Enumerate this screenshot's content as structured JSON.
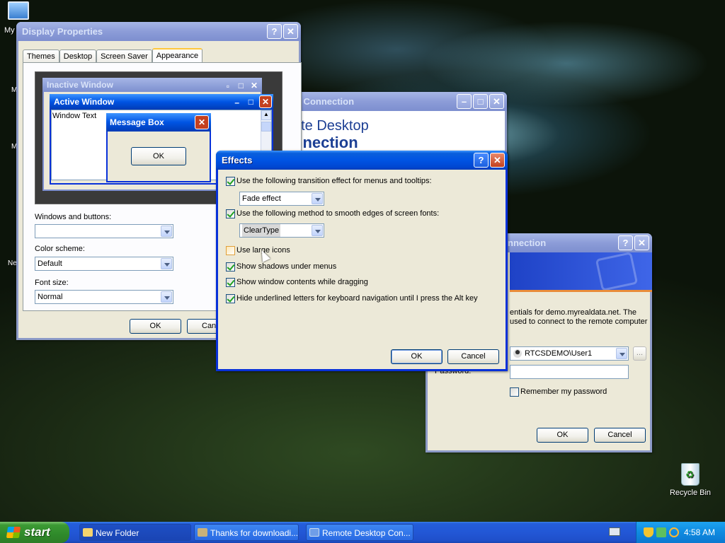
{
  "desktop": {
    "icons": {
      "my_computer": "My",
      "recycle_bin": "Recycle Bin"
    },
    "edge_labels": [
      "M",
      "M",
      "Ne"
    ]
  },
  "display_properties": {
    "title": "Display Properties",
    "tabs": [
      "Themes",
      "Desktop",
      "Screen Saver",
      "Appearance"
    ],
    "active_tab": "Appearance",
    "preview": {
      "inactive_title": "Inactive Window",
      "active_title": "Active Window",
      "window_text": "Window Text",
      "message_box_title": "Message Box",
      "message_box_ok": "OK"
    },
    "windows_and_buttons_label": "Windows and buttons:",
    "windows_and_buttons_value": "",
    "color_scheme_label": "Color scheme:",
    "color_scheme_value": "Default",
    "font_size_label": "Font size:",
    "font_size_value": "Normal",
    "ok_label": "OK",
    "cancel_label": "Canc"
  },
  "rdc_back": {
    "title": "o Connection",
    "banner_line1": "ote Desktop",
    "banner_line2": "nnection"
  },
  "rdc_login": {
    "title": "nnection",
    "desc_line1": "entials for demo.myrealdata.net. The",
    "desc_line2": "used to connect to the remote computer",
    "user_value": "RTCSDEMO\\User1",
    "browse_label": "...",
    "password_label": "Password:",
    "password_value": "",
    "remember_label": "Remember my password",
    "ok_label": "OK",
    "cancel_label": "Cancel"
  },
  "effects": {
    "title": "Effects",
    "transition_label": "Use the following transition effect for menus and tooltips:",
    "transition_value": "Fade effect",
    "smooth_label": "Use the following method to smooth edges of screen fonts:",
    "smooth_value": "ClearType",
    "large_icons_label": "Use large icons",
    "shadows_label": "Show shadows under menus",
    "drag_label": "Show window contents while dragging",
    "underline_label": "Hide underlined letters for keyboard navigation until I press the Alt key",
    "ok_label": "OK",
    "cancel_label": "Cancel"
  },
  "taskbar": {
    "start_label": "start",
    "tasks": [
      "New Folder",
      "Thanks for downloadi...",
      "Remote Desktop Con..."
    ],
    "clock": "4:58 AM"
  }
}
